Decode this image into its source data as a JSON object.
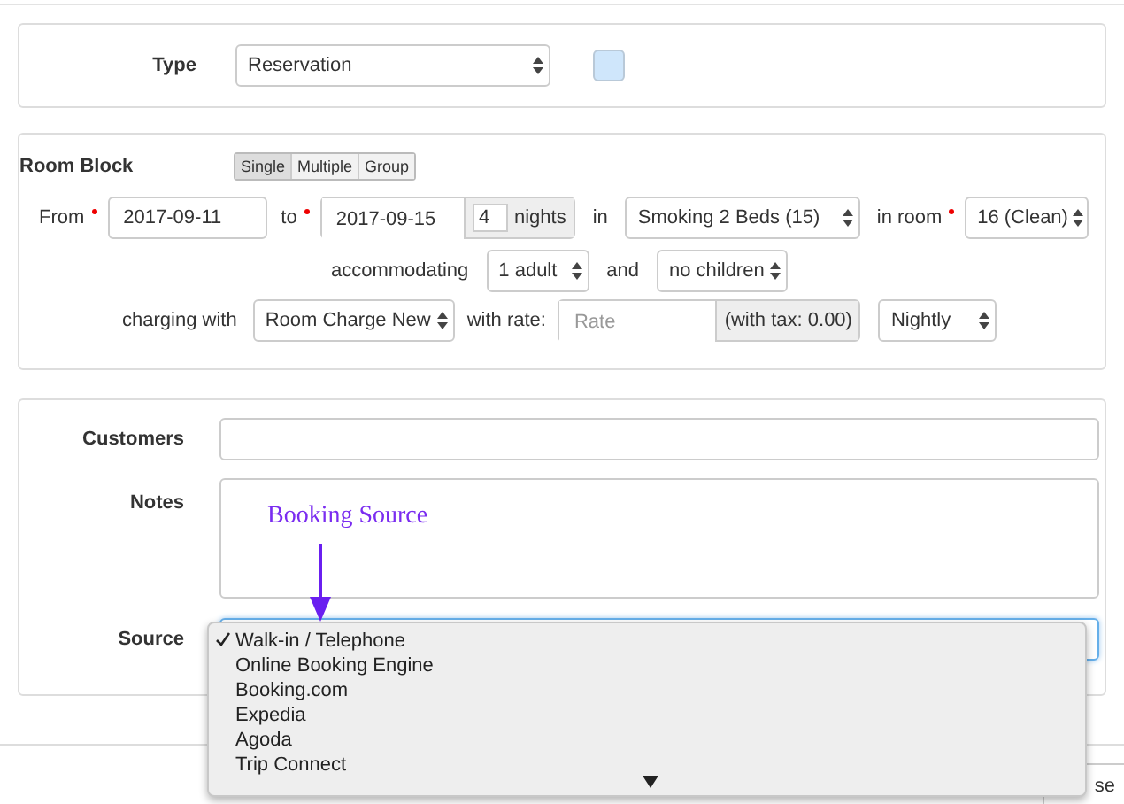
{
  "type_section": {
    "label": "Type",
    "value": "Reservation",
    "color": "#cfe6fb"
  },
  "room_block": {
    "label": "Room Block",
    "modes": [
      {
        "label": "Single",
        "selected": true
      },
      {
        "label": "Multiple",
        "selected": false
      },
      {
        "label": "Group",
        "selected": false
      }
    ],
    "from_label": "From",
    "from_required": true,
    "from": "2017-09-11",
    "to_label": "to",
    "to_required": true,
    "to": "2017-09-15",
    "nights": "4",
    "nights_label": "nights",
    "in_label": "in",
    "room_type": "Smoking 2 Beds (15)",
    "in_room_label": "in room",
    "room_required": true,
    "room": "16 (Clean)",
    "accommodating_label": "accommodating",
    "adults": "1 adult",
    "and_label": "and",
    "children": "no children",
    "charging_label": "charging with",
    "charge": "Room Charge New",
    "rate_label": "with rate:",
    "rate_placeholder": "Rate",
    "tax": "(with tax: 0.00)",
    "frequency": "Nightly"
  },
  "details": {
    "customers_label": "Customers",
    "notes_label": "Notes",
    "source_label": "Source"
  },
  "annotation": {
    "text": "Booking Source"
  },
  "source_menu": {
    "options": [
      {
        "label": "Walk-in / Telephone",
        "selected": true
      },
      {
        "label": "Online Booking Engine",
        "selected": false
      },
      {
        "label": "Booking.com",
        "selected": false
      },
      {
        "label": "Expedia",
        "selected": false
      },
      {
        "label": "Agoda",
        "selected": false
      },
      {
        "label": "Trip Connect",
        "selected": false
      }
    ]
  },
  "footer": {
    "button": "se"
  }
}
